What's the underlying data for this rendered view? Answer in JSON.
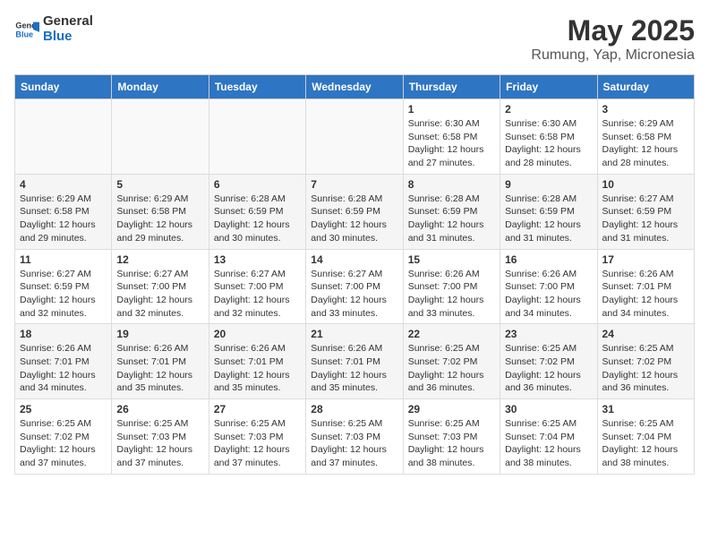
{
  "header": {
    "logo_general": "General",
    "logo_blue": "Blue",
    "title": "May 2025",
    "subtitle": "Rumung, Yap, Micronesia"
  },
  "weekdays": [
    "Sunday",
    "Monday",
    "Tuesday",
    "Wednesday",
    "Thursday",
    "Friday",
    "Saturday"
  ],
  "weeks": [
    [
      {
        "day": "",
        "info": ""
      },
      {
        "day": "",
        "info": ""
      },
      {
        "day": "",
        "info": ""
      },
      {
        "day": "",
        "info": ""
      },
      {
        "day": "1",
        "info": "Sunrise: 6:30 AM\nSunset: 6:58 PM\nDaylight: 12 hours\nand 27 minutes."
      },
      {
        "day": "2",
        "info": "Sunrise: 6:30 AM\nSunset: 6:58 PM\nDaylight: 12 hours\nand 28 minutes."
      },
      {
        "day": "3",
        "info": "Sunrise: 6:29 AM\nSunset: 6:58 PM\nDaylight: 12 hours\nand 28 minutes."
      }
    ],
    [
      {
        "day": "4",
        "info": "Sunrise: 6:29 AM\nSunset: 6:58 PM\nDaylight: 12 hours\nand 29 minutes."
      },
      {
        "day": "5",
        "info": "Sunrise: 6:29 AM\nSunset: 6:58 PM\nDaylight: 12 hours\nand 29 minutes."
      },
      {
        "day": "6",
        "info": "Sunrise: 6:28 AM\nSunset: 6:59 PM\nDaylight: 12 hours\nand 30 minutes."
      },
      {
        "day": "7",
        "info": "Sunrise: 6:28 AM\nSunset: 6:59 PM\nDaylight: 12 hours\nand 30 minutes."
      },
      {
        "day": "8",
        "info": "Sunrise: 6:28 AM\nSunset: 6:59 PM\nDaylight: 12 hours\nand 31 minutes."
      },
      {
        "day": "9",
        "info": "Sunrise: 6:28 AM\nSunset: 6:59 PM\nDaylight: 12 hours\nand 31 minutes."
      },
      {
        "day": "10",
        "info": "Sunrise: 6:27 AM\nSunset: 6:59 PM\nDaylight: 12 hours\nand 31 minutes."
      }
    ],
    [
      {
        "day": "11",
        "info": "Sunrise: 6:27 AM\nSunset: 6:59 PM\nDaylight: 12 hours\nand 32 minutes."
      },
      {
        "day": "12",
        "info": "Sunrise: 6:27 AM\nSunset: 7:00 PM\nDaylight: 12 hours\nand 32 minutes."
      },
      {
        "day": "13",
        "info": "Sunrise: 6:27 AM\nSunset: 7:00 PM\nDaylight: 12 hours\nand 32 minutes."
      },
      {
        "day": "14",
        "info": "Sunrise: 6:27 AM\nSunset: 7:00 PM\nDaylight: 12 hours\nand 33 minutes."
      },
      {
        "day": "15",
        "info": "Sunrise: 6:26 AM\nSunset: 7:00 PM\nDaylight: 12 hours\nand 33 minutes."
      },
      {
        "day": "16",
        "info": "Sunrise: 6:26 AM\nSunset: 7:00 PM\nDaylight: 12 hours\nand 34 minutes."
      },
      {
        "day": "17",
        "info": "Sunrise: 6:26 AM\nSunset: 7:01 PM\nDaylight: 12 hours\nand 34 minutes."
      }
    ],
    [
      {
        "day": "18",
        "info": "Sunrise: 6:26 AM\nSunset: 7:01 PM\nDaylight: 12 hours\nand 34 minutes."
      },
      {
        "day": "19",
        "info": "Sunrise: 6:26 AM\nSunset: 7:01 PM\nDaylight: 12 hours\nand 35 minutes."
      },
      {
        "day": "20",
        "info": "Sunrise: 6:26 AM\nSunset: 7:01 PM\nDaylight: 12 hours\nand 35 minutes."
      },
      {
        "day": "21",
        "info": "Sunrise: 6:26 AM\nSunset: 7:01 PM\nDaylight: 12 hours\nand 35 minutes."
      },
      {
        "day": "22",
        "info": "Sunrise: 6:25 AM\nSunset: 7:02 PM\nDaylight: 12 hours\nand 36 minutes."
      },
      {
        "day": "23",
        "info": "Sunrise: 6:25 AM\nSunset: 7:02 PM\nDaylight: 12 hours\nand 36 minutes."
      },
      {
        "day": "24",
        "info": "Sunrise: 6:25 AM\nSunset: 7:02 PM\nDaylight: 12 hours\nand 36 minutes."
      }
    ],
    [
      {
        "day": "25",
        "info": "Sunrise: 6:25 AM\nSunset: 7:02 PM\nDaylight: 12 hours\nand 37 minutes."
      },
      {
        "day": "26",
        "info": "Sunrise: 6:25 AM\nSunset: 7:03 PM\nDaylight: 12 hours\nand 37 minutes."
      },
      {
        "day": "27",
        "info": "Sunrise: 6:25 AM\nSunset: 7:03 PM\nDaylight: 12 hours\nand 37 minutes."
      },
      {
        "day": "28",
        "info": "Sunrise: 6:25 AM\nSunset: 7:03 PM\nDaylight: 12 hours\nand 37 minutes."
      },
      {
        "day": "29",
        "info": "Sunrise: 6:25 AM\nSunset: 7:03 PM\nDaylight: 12 hours\nand 38 minutes."
      },
      {
        "day": "30",
        "info": "Sunrise: 6:25 AM\nSunset: 7:04 PM\nDaylight: 12 hours\nand 38 minutes."
      },
      {
        "day": "31",
        "info": "Sunrise: 6:25 AM\nSunset: 7:04 PM\nDaylight: 12 hours\nand 38 minutes."
      }
    ]
  ]
}
